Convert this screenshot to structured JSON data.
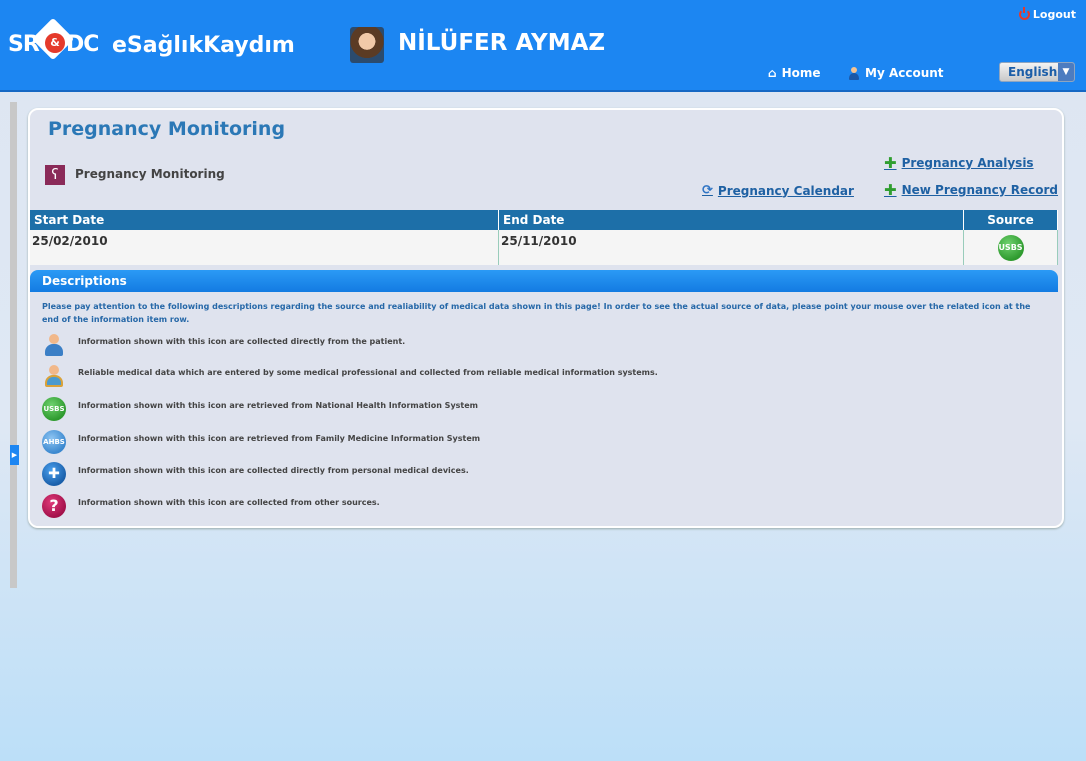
{
  "header": {
    "logo": {
      "left": "SR",
      "amp": "&",
      "right": "DC"
    },
    "app_title": "eSağlıkKaydım",
    "user_name": "NİLÜFER AYMAZ",
    "logout_label": "Logout",
    "nav": {
      "home_label": "Home",
      "account_label": "My Account"
    },
    "language": {
      "selected": "English"
    }
  },
  "page": {
    "title": "Pregnancy Monitoring",
    "section_label": "Pregnancy Monitoring",
    "actions": {
      "analysis": "Pregnancy Analysis",
      "calendar": "Pregnancy Calendar",
      "new_record": "New Pregnancy Record"
    }
  },
  "table": {
    "columns": [
      "Start Date",
      "End Date",
      "Source"
    ],
    "rows": [
      {
        "start": "25/02/2010",
        "end": "25/11/2010",
        "source": "USBS"
      }
    ]
  },
  "descriptions": {
    "title": "Descriptions",
    "intro": "Please pay attention to the following descriptions regarding the source and realiability of medical data shown in this page! In order to see the actual source of data, please point your mouse over the related icon at the end of the information item row.",
    "items": [
      {
        "icon": "patient-icon",
        "text": "Information shown with this icon are collected directly from the patient."
      },
      {
        "icon": "medical-professional-icon",
        "text": "Reliable medical data which are entered by some medical professional and collected from reliable medical information systems."
      },
      {
        "icon": "usbs-icon",
        "badge": "USBS",
        "text": "Information shown with this icon are retrieved from National Health Information System"
      },
      {
        "icon": "ahbs-icon",
        "badge": "AHBS",
        "text": "Information shown with this icon are retrieved from Family Medicine Information System"
      },
      {
        "icon": "medical-device-icon",
        "text": "Information shown with this icon are collected directly from personal medical devices."
      },
      {
        "icon": "other-source-icon",
        "text": "Information shown with this icon are collected from other sources."
      }
    ]
  },
  "colors": {
    "header_bg": "#1c86f2",
    "table_header_bg": "#1d6fa8",
    "title_blue": "#2b78b6",
    "link_blue": "#1f61a3",
    "plus_green": "#2f9e2f"
  }
}
